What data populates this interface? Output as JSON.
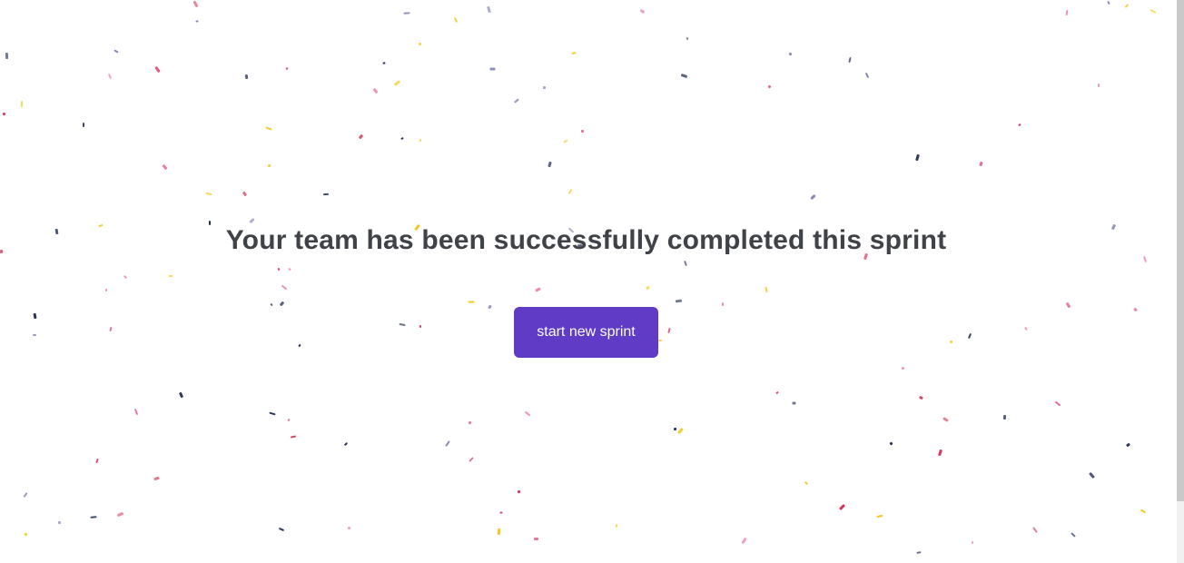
{
  "main": {
    "title": "Your team has been successfully completed this sprint",
    "button_label": "start new sprint"
  },
  "colors": {
    "accent": "#5f3bc6",
    "title_text": "#3f4348",
    "confetti": [
      "#f5c518",
      "#1f2a52",
      "#d6335a",
      "#e86a8c",
      "#7b7fb0"
    ]
  }
}
